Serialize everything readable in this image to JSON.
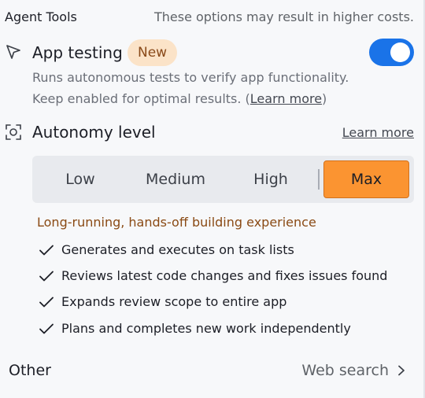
{
  "header": {
    "section_title": "Agent Tools",
    "cost_note": "These options may result in higher costs."
  },
  "app_testing": {
    "icon": "cursor-pointer-icon",
    "title": "App testing",
    "badge": "New",
    "toggle_state": "on",
    "description_line1": "Runs autonomous tests to verify app functionality.",
    "description_line2_prefix": "Keep enabled for optimal results. (",
    "description_link": "Learn more",
    "description_line2_suffix": ")"
  },
  "autonomy": {
    "icon": "focus-scan-icon",
    "title": "Autonomy level",
    "learn_more": "Learn more",
    "levels": [
      "Low",
      "Medium",
      "High",
      "Max"
    ],
    "selected": "Max"
  },
  "max_details": {
    "heading": "Long-running, hands-off building experience",
    "features": [
      "Generates and executes on task lists",
      "Reviews latest code changes and fixes issues found",
      "Expands review scope to entire app",
      "Plans and completes new work independently"
    ]
  },
  "footer": {
    "other_label": "Other",
    "web_search": "Web search"
  },
  "colors": {
    "toggle_on": "#1a73e8",
    "selected_level": "#fb9431",
    "badge_bg": "#fbe3c8",
    "feature_heading": "#8a4a14"
  }
}
